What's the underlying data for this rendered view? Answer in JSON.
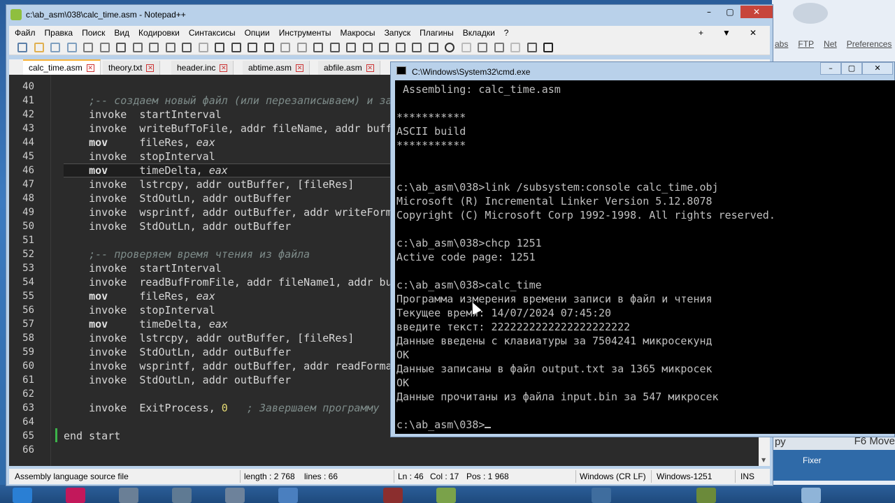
{
  "colors": {
    "editor_bg": "#2b2b2b",
    "console_bg": "#000000",
    "window_frame": "#b9d1ea",
    "close_button": "#c7453b",
    "tab_active_marker": "#f7b33a"
  },
  "npp": {
    "title": "c:\\ab_asm\\038\\calc_time.asm - Notepad++",
    "window_buttons": {
      "minimize": "–",
      "maximize": "▢",
      "close": "✕"
    },
    "menu": [
      "Файл",
      "Правка",
      "Поиск",
      "Вид",
      "Кодировки",
      "Синтаксисы",
      "Опции",
      "Инструменты",
      "Макросы",
      "Запуск",
      "Плагины",
      "Вкладки",
      "?"
    ],
    "menu_right": [
      "+",
      "▼",
      "✕"
    ],
    "tabs": [
      {
        "label": "calc_time.asm",
        "active": true
      },
      {
        "label": "theory.txt",
        "active": false
      },
      {
        "label": "header.inc",
        "active": false
      },
      {
        "label": "abtime.asm",
        "active": false
      },
      {
        "label": "abfile.asm",
        "active": false
      }
    ],
    "toolbar_icons": [
      "new-file-icon",
      "open-icon",
      "save-icon",
      "save-all-icon",
      "close-icon",
      "close-all-icon",
      "print-icon",
      "cut-icon",
      "copy-icon",
      "paste-icon",
      "undo-icon",
      "redo-icon",
      "find-icon",
      "replace-icon",
      "zoom-in-icon",
      "zoom-out-icon",
      "sync-v-icon",
      "sync-h-icon",
      "wrap-icon",
      "show-all-icon",
      "indent-guide-icon",
      "xml-icon",
      "doc-map-icon",
      "function-list-icon",
      "folder-workspace-icon",
      "monitor-icon",
      "record-macro-icon",
      "stop-macro-icon",
      "play-macro-icon",
      "run-multiple-icon",
      "save-macro-icon",
      "spell-icon",
      "terminal-icon"
    ],
    "status": {
      "file_type": "Assembly language source file",
      "length": "length : 2 768",
      "lines": "lines : 66",
      "ln": "Ln : 46",
      "col": "Col : 17",
      "pos": "Pos : 1 968",
      "eol": "Windows (CR LF)",
      "encoding": "Windows-1251",
      "mode": "INS"
    },
    "lines": [
      {
        "n": "40",
        "parts": []
      },
      {
        "n": "41",
        "parts": [
          [
            "cm",
            "    ;-- создаем новый файл (или перезаписываем) и за"
          ]
        ]
      },
      {
        "n": "42",
        "parts": [
          [
            "kw",
            "    invoke  "
          ],
          [
            "plain",
            "startInterval"
          ]
        ]
      },
      {
        "n": "43",
        "parts": [
          [
            "kw",
            "    invoke  "
          ],
          [
            "plain",
            "writeBufToFile, addr fileName, addr buff"
          ]
        ]
      },
      {
        "n": "44",
        "parts": [
          [
            "ins",
            "    mov     "
          ],
          [
            "plain",
            "fileRes, "
          ],
          [
            "reg",
            "eax"
          ]
        ]
      },
      {
        "n": "45",
        "parts": [
          [
            "kw",
            "    invoke  "
          ],
          [
            "plain",
            "stopInterval"
          ]
        ]
      },
      {
        "n": "46",
        "parts": [
          [
            "ins",
            "    mov     "
          ],
          [
            "plain",
            "timeDelta, "
          ],
          [
            "reg",
            "eax"
          ]
        ]
      },
      {
        "n": "47",
        "parts": [
          [
            "kw",
            "    invoke  "
          ],
          [
            "plain",
            "lstrcpy, addr outBuffer, [fileRes]"
          ]
        ]
      },
      {
        "n": "48",
        "parts": [
          [
            "kw",
            "    invoke  "
          ],
          [
            "plain",
            "StdOutLn, addr outBuffer"
          ]
        ]
      },
      {
        "n": "49",
        "parts": [
          [
            "kw",
            "    invoke  "
          ],
          [
            "plain",
            "wsprintf, addr outBuffer, addr writeForm"
          ]
        ]
      },
      {
        "n": "50",
        "parts": [
          [
            "kw",
            "    invoke  "
          ],
          [
            "plain",
            "StdOutLn, addr outBuffer"
          ]
        ]
      },
      {
        "n": "51",
        "parts": []
      },
      {
        "n": "52",
        "parts": [
          [
            "cm",
            "    ;-- проверяем время чтения из файла"
          ]
        ]
      },
      {
        "n": "53",
        "parts": [
          [
            "kw",
            "    invoke  "
          ],
          [
            "plain",
            "startInterval"
          ]
        ]
      },
      {
        "n": "54",
        "parts": [
          [
            "kw",
            "    invoke  "
          ],
          [
            "plain",
            "readBufFromFile, addr fileName1, addr bu"
          ]
        ]
      },
      {
        "n": "55",
        "parts": [
          [
            "ins",
            "    mov     "
          ],
          [
            "plain",
            "fileRes, "
          ],
          [
            "reg",
            "eax"
          ]
        ]
      },
      {
        "n": "56",
        "parts": [
          [
            "kw",
            "    invoke  "
          ],
          [
            "plain",
            "stopInterval"
          ]
        ]
      },
      {
        "n": "57",
        "parts": [
          [
            "ins",
            "    mov     "
          ],
          [
            "plain",
            "timeDelta, "
          ],
          [
            "reg",
            "eax"
          ]
        ]
      },
      {
        "n": "58",
        "parts": [
          [
            "kw",
            "    invoke  "
          ],
          [
            "plain",
            "lstrcpy, addr outBuffer, [fileRes]"
          ]
        ]
      },
      {
        "n": "59",
        "parts": [
          [
            "kw",
            "    invoke  "
          ],
          [
            "plain",
            "StdOutLn, addr outBuffer"
          ]
        ]
      },
      {
        "n": "60",
        "parts": [
          [
            "kw",
            "    invoke  "
          ],
          [
            "plain",
            "wsprintf, addr outBuffer, addr readForma"
          ]
        ]
      },
      {
        "n": "61",
        "parts": [
          [
            "kw",
            "    invoke  "
          ],
          [
            "plain",
            "StdOutLn, addr outBuffer"
          ]
        ]
      },
      {
        "n": "62",
        "parts": []
      },
      {
        "n": "63",
        "parts": [
          [
            "kw",
            "    invoke  "
          ],
          [
            "plain",
            "ExitProcess, "
          ],
          [
            "num",
            "0"
          ],
          [
            "cm",
            "   ; Завершаем программу"
          ]
        ]
      },
      {
        "n": "64",
        "parts": []
      },
      {
        "n": "65",
        "parts": [
          [
            "plain",
            "end start"
          ]
        ]
      },
      {
        "n": "66",
        "parts": []
      }
    ]
  },
  "cmd": {
    "title": "C:\\Windows\\System32\\cmd.exe",
    "window_buttons": {
      "minimize": "–",
      "maximize": "▢",
      "close": "✕"
    },
    "lines": [
      " Assembling: calc_time.asm",
      "",
      "***********",
      "ASCII build",
      "***********",
      "",
      "",
      "c:\\ab_asm\\038>link /subsystem:console calc_time.obj",
      "Microsoft (R) Incremental Linker Version 5.12.8078",
      "Copyright (C) Microsoft Corp 1992-1998. All rights reserved.",
      "",
      "c:\\ab_asm\\038>chcp 1251",
      "Active code page: 1251",
      "",
      "c:\\ab_asm\\038>calc_time",
      "Программа измерения времени записи в файл и чтения",
      "Текущее время: 14/07/2024 07:45:20",
      "введите текст: 2222222222222222222222",
      "Данные введены с клавиатуры за 7504241 микросекунд",
      "OK",
      "Данные записаны в файл output.txt за 1365 микросек",
      "OK",
      "Данные прочитаны из файла input.bin за 547 микросек",
      "",
      "c:\\ab_asm\\038>"
    ]
  },
  "background_app": {
    "tabs": [
      "abs",
      "FTP",
      "Net",
      "Preferences"
    ],
    "strip_left": "ру",
    "strip_right": "F6 Move",
    "fixer_label": "Fixer"
  }
}
